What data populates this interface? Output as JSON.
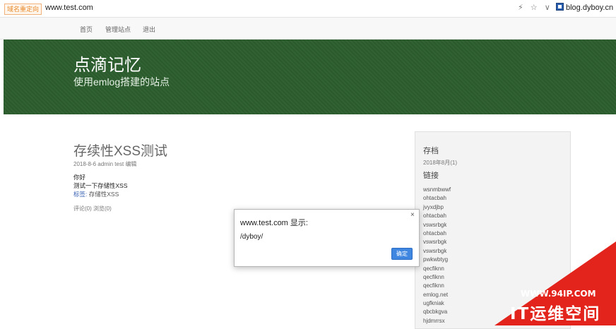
{
  "browser": {
    "redirect_tag": "域名重定向",
    "url": "www.test.com",
    "icons": [
      "lightning-icon",
      "star-icon",
      "chevron-down-icon"
    ],
    "bookmark_label": "blog.dyboy.cn"
  },
  "nav": {
    "items": [
      {
        "label": "首页"
      },
      {
        "label": "管理站点"
      },
      {
        "label": "退出"
      }
    ]
  },
  "header": {
    "title": "点滴记忆",
    "subtitle": "使用emlog搭建的站点",
    "bg_color": "#2c5e2e"
  },
  "post": {
    "title": "存续性XSS测试",
    "date": "2018-8-6",
    "author": "admin",
    "category": "test",
    "edit_label": "编辑",
    "body_line1": "你好",
    "body_line2": "测试一下存储性XSS",
    "tag_label": "标签:",
    "tag_value": "存储性XSS",
    "comments": "评论(0)",
    "views": "浏览(0)"
  },
  "sidebar": {
    "archive_heading": "存档",
    "archive_item": "2018年8月(1)",
    "links_heading": "链接",
    "links": [
      "wsnmbwwf",
      "ohtacbah",
      "jvyxdjbp",
      "ohtacbah",
      "vswsrbgk",
      "ohtacbah",
      "vswsrbgk",
      "vswsrbgk",
      "pwkwbtyg",
      "qecfiknn",
      "qecfiknn",
      "qecfiknn",
      "emlog.net",
      "ugfkniak",
      "qbcbkgva",
      "hjdmrrsx"
    ]
  },
  "dialog": {
    "title": "www.test.com 显示:",
    "message": "/dyboy/",
    "ok_label": "确定",
    "close_icon": "×"
  },
  "watermark": {
    "url": "WWW.94IP.COM",
    "name": "IT运维空间",
    "color": "#e2241c"
  }
}
